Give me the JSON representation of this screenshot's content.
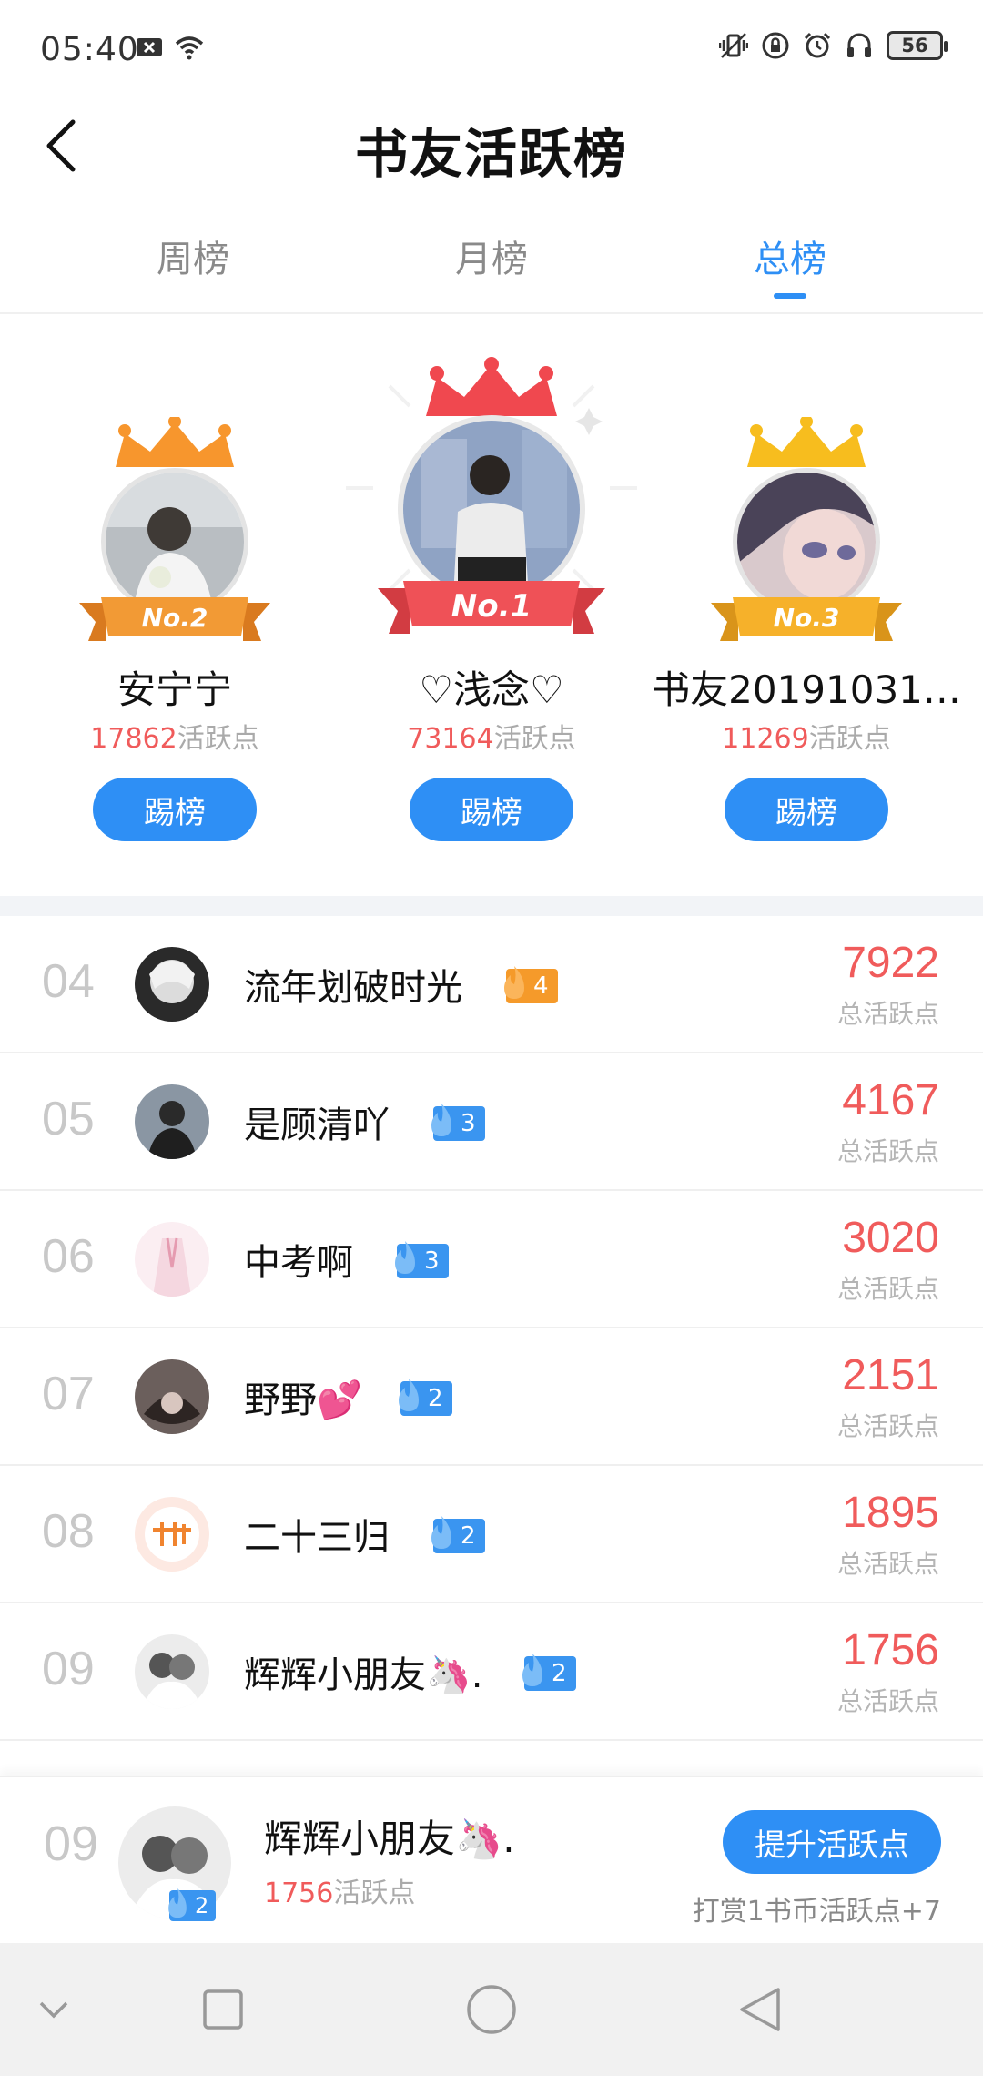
{
  "status_bar": {
    "time": "05:40",
    "battery": "56",
    "icons": [
      "close-box-icon",
      "wifi-icon",
      "vibrate-icon",
      "lock-rotation-icon",
      "alarm-icon",
      "headphones-icon"
    ]
  },
  "header": {
    "title": "书友活跃榜",
    "back_icon": "chevron-left-icon"
  },
  "tabs": [
    {
      "label": "周榜",
      "active": false
    },
    {
      "label": "月榜",
      "active": false
    },
    {
      "label": "总榜",
      "active": true
    }
  ],
  "podium": [
    {
      "rank_label": "No.2",
      "name": "安宁宁",
      "points": "17862",
      "points_unit": "活跃点",
      "button": "踢榜",
      "crown_color": "#f7962d",
      "ribbon_color": "#f29a35"
    },
    {
      "rank_label": "No.1",
      "name": "♡浅念♡",
      "points": "73164",
      "points_unit": "活跃点",
      "button": "踢榜",
      "crown_color": "#f0484f",
      "ribbon_color": "#ef5157"
    },
    {
      "rank_label": "No.3",
      "name": "书友20191031…",
      "points": "11269",
      "points_unit": "活跃点",
      "button": "踢榜",
      "crown_color": "#f7bd1e",
      "ribbon_color": "#f6b12a"
    }
  ],
  "list": [
    {
      "rank": "04",
      "name": "流年划破时光",
      "level": "4",
      "badge_color": "orange",
      "score": "7922",
      "score_label": "总活跃点"
    },
    {
      "rank": "05",
      "name": "是顾清吖",
      "level": "3",
      "badge_color": "blue",
      "score": "4167",
      "score_label": "总活跃点"
    },
    {
      "rank": "06",
      "name": "中考啊",
      "level": "3",
      "badge_color": "blue",
      "score": "3020",
      "score_label": "总活跃点"
    },
    {
      "rank": "07",
      "name": "野野💕",
      "level": "2",
      "badge_color": "blue",
      "score": "2151",
      "score_label": "总活跃点"
    },
    {
      "rank": "08",
      "name": "二十三归",
      "level": "2",
      "badge_color": "blue",
      "score": "1895",
      "score_label": "总活跃点"
    },
    {
      "rank": "09",
      "name": "辉辉小朋友🦄.",
      "level": "2",
      "badge_color": "blue",
      "score": "1756",
      "score_label": "总活跃点"
    }
  ],
  "my_rank": {
    "rank": "09",
    "name": "辉辉小朋友🦄.",
    "level": "2",
    "points": "1756",
    "points_unit": "活跃点",
    "button": "提升活跃点",
    "tip": "打赏1书币活跃点+7"
  },
  "nav_bar": {
    "icons": [
      "chevron-down-icon",
      "square-icon",
      "circle-home-icon",
      "triangle-back-icon"
    ]
  }
}
